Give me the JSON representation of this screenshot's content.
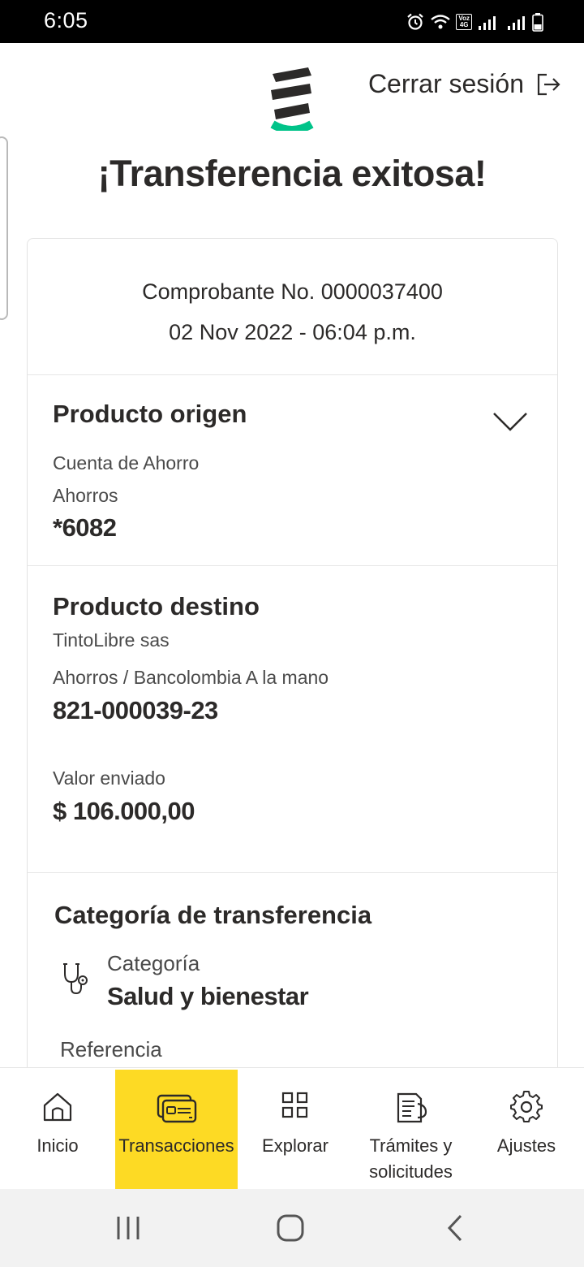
{
  "status_bar": {
    "time": "6:05",
    "network_badge_top": "Voz",
    "network_badge_bottom": "4G"
  },
  "header": {
    "logout_label": "Cerrar sesión"
  },
  "page": {
    "title": "¡Transferencia exitosa!"
  },
  "receipt": {
    "number": "Comprobante No. 0000037400",
    "date": "02 Nov 2022 - 06:04 p.m."
  },
  "origin": {
    "title": "Producto origen",
    "account_name": "Cuenta de Ahorro",
    "account_type": "Ahorros",
    "account_number": "*6082"
  },
  "destination": {
    "title": "Producto destino",
    "holder": "TintoLibre sas",
    "account_type": "Ahorros / Bancolombia A la mano",
    "account_number": "821-000039-23",
    "amount_label": "Valor enviado",
    "amount_value": "$ 106.000,00"
  },
  "category": {
    "title": "Categoría de transferencia",
    "label": "Categoría",
    "value": "Salud y bienestar",
    "reference_label": "Referencia",
    "icon": "stethoscope-icon"
  },
  "bottom_nav": {
    "items": [
      {
        "label": "Inicio",
        "icon": "home-icon"
      },
      {
        "label": "Transacciones",
        "icon": "card-cash-icon",
        "active": true
      },
      {
        "label": "Explorar",
        "icon": "grid-icon"
      },
      {
        "label": "Trámites y solicitudes",
        "icon": "document-icon"
      },
      {
        "label": "Ajustes",
        "icon": "gear-icon"
      }
    ]
  },
  "colors": {
    "accent_yellow": "#fdda24",
    "brand_green": "#00c389",
    "text_dark": "#2c2a29"
  }
}
